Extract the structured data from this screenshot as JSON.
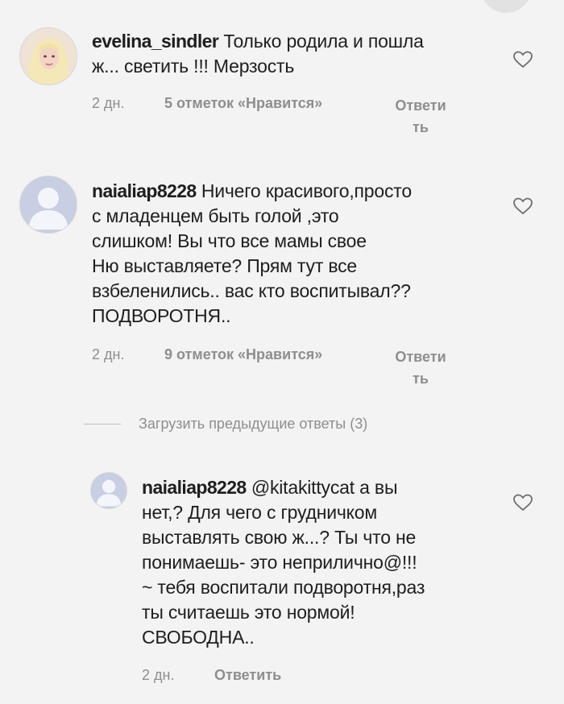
{
  "comments": [
    {
      "username": "evelina_sindler",
      "text_line1": " Только родила и пошла",
      "text_line2": "ж... светить !!! Мерзость",
      "time": "2 дн.",
      "likes": "5 отметок «Нравится»",
      "reply_line1": "Ответи",
      "reply_line2": "ть"
    },
    {
      "username": "naialiap8228",
      "text_line1": " Ничего красивого,просто",
      "text_line2": "с младенцем быть голой ,это",
      "text_line3": "слишком! Вы что все мамы свое",
      "text_line4": "Ню выставляете? Прям тут все",
      "text_line5": "взбеленились.. вас кто воспитывал??",
      "text_line6": "ПОДВОРОТНЯ..",
      "time": "2 дн.",
      "likes": "9 отметок «Нравится»",
      "reply_line1": "Ответи",
      "reply_line2": "ть"
    }
  ],
  "load_more": "Загрузить предыдущие ответы (3)",
  "reply_comment": {
    "username": "naialiap8228",
    "mention": "@kitakittycat",
    "text_line1_rest": " а вы",
    "text_line2": "нет,? Для чего с грудничком",
    "text_line3": "выставлять свою ж...? Ты что  не",
    "text_line4": "понимаешь- это  неприлично@!!!",
    "text_line5": "~ тебя воспитали подворотня,раз",
    "text_line6": "ты считаешь это нормой!",
    "text_line7": "СВОБОДНА..",
    "time": "2 дн.",
    "reply": "Ответить"
  },
  "icons": {
    "like": "heart-outline-icon",
    "default_avatar": "default-avatar-icon"
  },
  "colors": {
    "background": "#f3f3f3",
    "text": "#1e1e1e",
    "meta": "#8e8e8e"
  }
}
